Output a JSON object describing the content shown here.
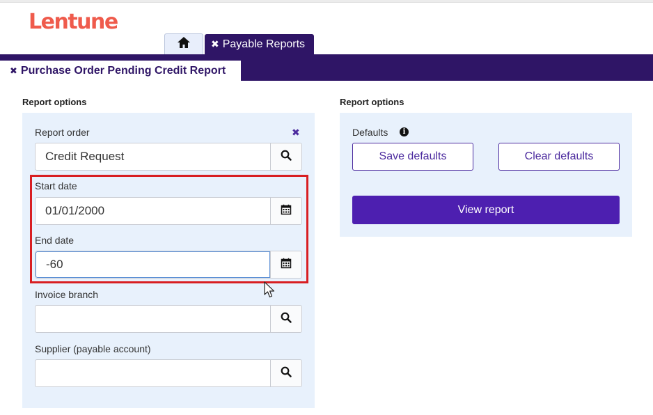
{
  "brand": {
    "logo_text": "Lentune",
    "logo_color": "#ef5b4c"
  },
  "tabs": {
    "home_icon": "home-icon",
    "payable_reports": {
      "label": "Payable Reports",
      "close": "✖"
    }
  },
  "sub_tab": {
    "label": "Purchase Order Pending Credit Report",
    "close": "✖"
  },
  "left_panel": {
    "title": "Report options",
    "report_order": {
      "label": "Report order",
      "value": "Credit Request",
      "clear": "✖"
    },
    "start_date": {
      "label": "Start date",
      "value": "01/01/2000"
    },
    "end_date": {
      "label": "End date",
      "value": "-60"
    },
    "invoice_branch": {
      "label": "Invoice branch",
      "value": ""
    },
    "supplier": {
      "label": "Supplier (payable account)",
      "value": ""
    }
  },
  "right_panel": {
    "title": "Report options",
    "defaults_label": "Defaults",
    "info_glyph": "i",
    "save_defaults": "Save defaults",
    "clear_defaults": "Clear defaults",
    "view_report": "View report"
  },
  "colors": {
    "nav": "#2f1566",
    "accent": "#4d1fb0",
    "panel": "#e8f1fc",
    "highlight": "#d81e22"
  }
}
